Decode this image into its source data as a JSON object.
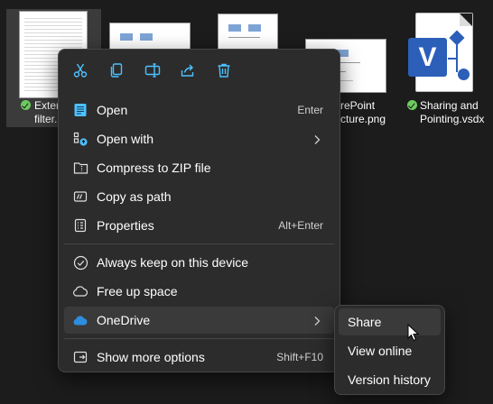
{
  "files": [
    {
      "label_line1": "Exter",
      "label_line2": "filter.",
      "synced": true
    },
    {
      "label_line1": "rePoint",
      "label_line2": "cture.png"
    },
    {
      "label_line1": "Sharing and",
      "label_line2": "Pointing.vsdx",
      "synced": true,
      "icon_letter": "V"
    }
  ],
  "toolbar": [
    {
      "name": "cut-icon"
    },
    {
      "name": "copy-icon"
    },
    {
      "name": "rename-icon"
    },
    {
      "name": "share-icon"
    },
    {
      "name": "delete-icon"
    }
  ],
  "menu": {
    "items": [
      {
        "label": "Open",
        "shortcut": "Enter"
      },
      {
        "label": "Open with"
      },
      {
        "label": "Compress to ZIP file"
      },
      {
        "label": "Copy as path"
      },
      {
        "label": "Properties",
        "shortcut": "Alt+Enter"
      },
      {
        "label": "Always keep on this device"
      },
      {
        "label": "Free up space"
      },
      {
        "label": "OneDrive"
      },
      {
        "label": "Show more options",
        "shortcut": "Shift+F10"
      }
    ]
  },
  "submenu": {
    "items": [
      {
        "label": "Share"
      },
      {
        "label": "View online"
      },
      {
        "label": "Version history"
      }
    ]
  },
  "colors": {
    "accent": "#4cc2ff",
    "sync_green": "#6ccb5f",
    "visio_blue": "#2b5fb8"
  }
}
